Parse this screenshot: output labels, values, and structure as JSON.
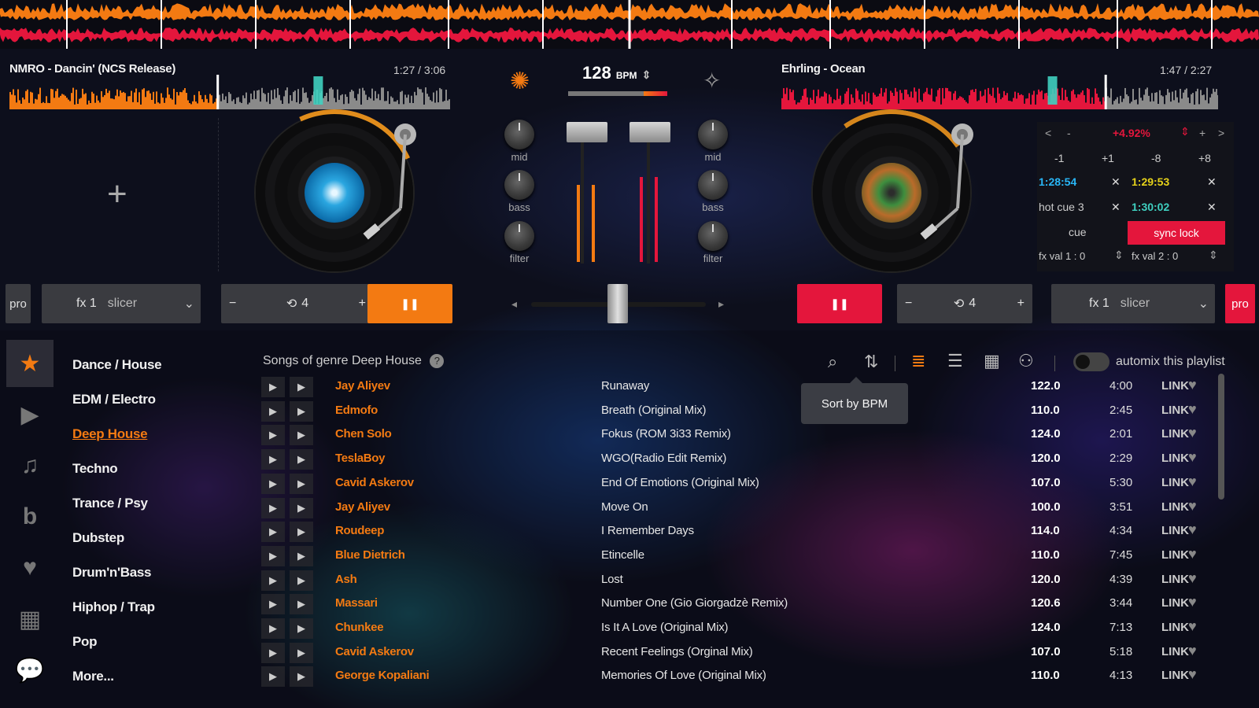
{
  "colors": {
    "deck_a": "#f37a12",
    "deck_b": "#e4163c",
    "accent_blue": "#29b6f6"
  },
  "deck_a": {
    "title": "NMRO - Dancin' (NCS Release)",
    "time": "1:27 / 3:06",
    "fx_label": "fx 1",
    "fx_name": "slicer",
    "pro_label": "pro",
    "loop_size": "4",
    "minus": "−",
    "plus": "+",
    "pause_label": "❚❚"
  },
  "deck_b": {
    "title": "Ehrling - Ocean",
    "time": "1:47 / 2:27",
    "fx_label": "fx 1",
    "fx_name": "slicer",
    "pro_label": "pro",
    "loop_size": "4",
    "minus": "−",
    "plus": "+",
    "pause_label": "❚❚"
  },
  "mixer": {
    "bpm": "128",
    "bpm_unit": "BPM",
    "knobs_left": [
      "mid",
      "bass",
      "filter"
    ],
    "knobs_right": [
      "mid",
      "bass",
      "filter"
    ]
  },
  "cue_panel": {
    "nav_left": [
      "<",
      "-"
    ],
    "pitch": "+4.92%",
    "nav_right": [
      "+",
      ">"
    ],
    "steps": [
      "-1",
      "+1",
      "-8",
      "+8"
    ],
    "cue1": "1:28:54",
    "cue2": "1:29:53",
    "cue3": "hot cue 3",
    "cue4": "1:30:02",
    "cue_label": "cue",
    "sync_label": "sync lock",
    "fx_val1": "fx val 1 : 0",
    "fx_val2": "fx val 2 : 0",
    "clear": "✕"
  },
  "library": {
    "heading": "Songs of genre Deep House",
    "automix_label": "automix this playlist",
    "tooltip": "Sort by BPM",
    "genres": [
      "Dance / House",
      "EDM / Electro",
      "Deep House",
      "Techno",
      "Trance / Psy",
      "Dubstep",
      "Drum'n'Bass",
      "Hiphop / Trap",
      "Pop",
      "More..."
    ],
    "link_label": "LINK",
    "tracks": [
      {
        "artist": "Jay Aliyev",
        "title": "Runaway",
        "bpm": "122.0",
        "duration": "4:00"
      },
      {
        "artist": "Edmofo",
        "title": "Breath (Original Mix)",
        "bpm": "110.0",
        "duration": "2:45"
      },
      {
        "artist": "Chen Solo",
        "title": "Fokus (ROM 3i33 Remix)",
        "bpm": "124.0",
        "duration": "2:01"
      },
      {
        "artist": "TeslaBoy",
        "title": "WGO(Radio Edit Remix)",
        "bpm": "120.0",
        "duration": "2:29"
      },
      {
        "artist": "Cavid Askerov",
        "title": "End Of Emotions (Original Mix)",
        "bpm": "107.0",
        "duration": "5:30"
      },
      {
        "artist": "Jay Aliyev",
        "title": "Move On",
        "bpm": "100.0",
        "duration": "3:51"
      },
      {
        "artist": "Roudeep",
        "title": "I Remember Days",
        "bpm": "114.0",
        "duration": "4:34"
      },
      {
        "artist": "Blue Dietrich",
        "title": "Etincelle",
        "bpm": "110.0",
        "duration": "7:45"
      },
      {
        "artist": "Ash",
        "title": "Lost",
        "bpm": "120.0",
        "duration": "4:39"
      },
      {
        "artist": "Massari",
        "title": "Number One (Gio Giorgadzè Remix)",
        "bpm": "120.6",
        "duration": "3:44"
      },
      {
        "artist": "Chunkee",
        "title": "Is It A Love (Original Mix)",
        "bpm": "124.0",
        "duration": "7:13"
      },
      {
        "artist": "Cavid Askerov",
        "title": "Recent Feelings (Orginal Mix)",
        "bpm": "107.0",
        "duration": "5:18"
      },
      {
        "artist": "George Kopaliani",
        "title": "Memories Of Love (Original Mix)",
        "bpm": "110.0",
        "duration": "4:13"
      }
    ]
  }
}
